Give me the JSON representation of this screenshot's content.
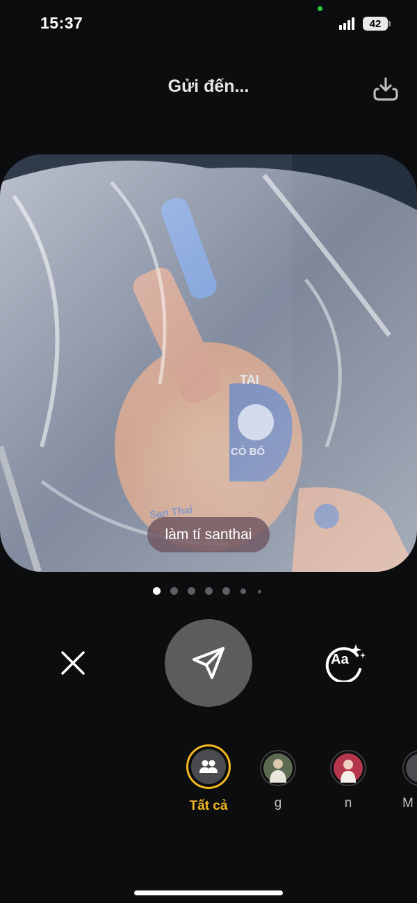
{
  "status_bar": {
    "time": "15:37",
    "battery": "42"
  },
  "header": {
    "title": "Gửi đến...",
    "download_icon": "download-icon"
  },
  "photo": {
    "printed_text": [
      "TAI",
      "CÓ BỐ",
      "San Thai"
    ],
    "caption": "làm tí santhai"
  },
  "pagination": {
    "count": 7,
    "active_index": 0
  },
  "actions": {
    "close_icon": "close-icon",
    "send_icon": "send-icon",
    "text_style_icon": "text-style-sparkle-icon",
    "text_style_label": "Aa"
  },
  "recipients": [
    {
      "label": "Tất cả",
      "icon": "group-icon",
      "selected": true
    },
    {
      "label": "g",
      "icon": "avatar",
      "selected": false
    },
    {
      "label": "n",
      "icon": "avatar",
      "selected": false
    },
    {
      "label": "M",
      "icon": "avatar",
      "selected": false
    }
  ],
  "colors": {
    "accent": "#f5b820",
    "background": "#0c0d0f",
    "send_button": "#5b5c5e",
    "caption_pill": "#6e5660"
  }
}
